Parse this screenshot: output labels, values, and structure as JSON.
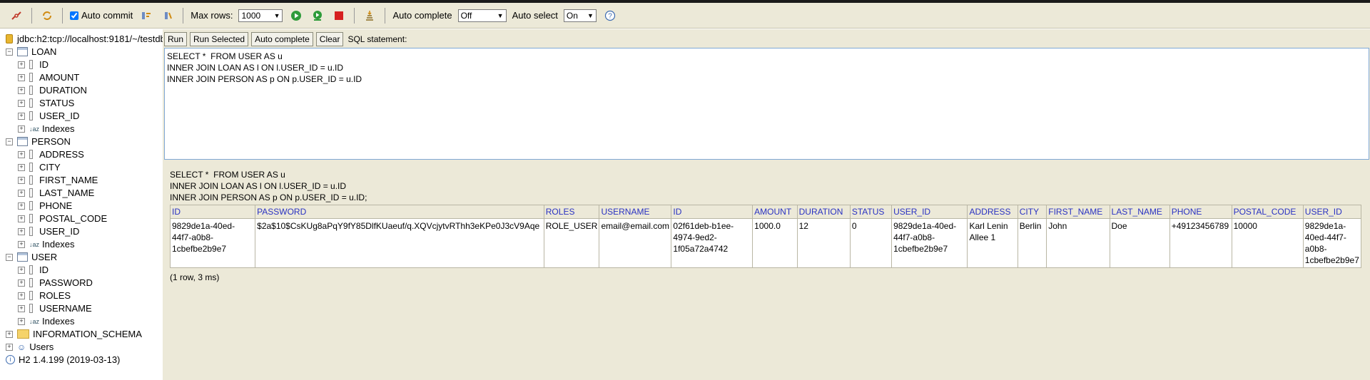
{
  "toolbar": {
    "auto_commit_label": "Auto commit",
    "max_rows_label": "Max rows:",
    "max_rows_value": "1000",
    "auto_complete_label": "Auto complete",
    "auto_complete_value": "Off",
    "auto_select_label": "Auto select",
    "auto_select_value": "On"
  },
  "tree": {
    "connection": "jdbc:h2:tcp://localhost:9181/~/testdb",
    "tables": [
      {
        "name": "LOAN",
        "columns": [
          "ID",
          "AMOUNT",
          "DURATION",
          "STATUS",
          "USER_ID"
        ],
        "indexes": "Indexes"
      },
      {
        "name": "PERSON",
        "columns": [
          "ADDRESS",
          "CITY",
          "FIRST_NAME",
          "LAST_NAME",
          "PHONE",
          "POSTAL_CODE",
          "USER_ID"
        ],
        "indexes": "Indexes"
      },
      {
        "name": "USER",
        "columns": [
          "ID",
          "PASSWORD",
          "ROLES",
          "USERNAME"
        ],
        "indexes": "Indexes"
      }
    ],
    "information_schema": "INFORMATION_SCHEMA",
    "users": "Users",
    "version": "H2 1.4.199 (2019-03-13)"
  },
  "editor": {
    "run": "Run",
    "run_selected": "Run Selected",
    "auto_complete": "Auto complete",
    "clear": "Clear",
    "sql_label": "SQL statement:",
    "sql": "SELECT *  FROM USER AS u\nINNER JOIN LOAN AS l ON l.USER_ID = u.ID\nINNER JOIN PERSON AS p ON p.USER_ID = u.ID"
  },
  "results": {
    "query": "SELECT *  FROM USER AS u\nINNER JOIN LOAN AS l ON l.USER_ID = u.ID\nINNER JOIN PERSON AS p ON p.USER_ID = u.ID;",
    "columns": [
      "ID",
      "PASSWORD",
      "ROLES",
      "USERNAME",
      "ID",
      "AMOUNT",
      "DURATION",
      "STATUS",
      "USER_ID",
      "ADDRESS",
      "CITY",
      "FIRST_NAME",
      "LAST_NAME",
      "PHONE",
      "POSTAL_CODE",
      "USER_ID"
    ],
    "rows": [
      [
        "9829de1a-40ed-44f7-a0b8-1cbefbe2b9e7",
        "$2a$10$CsKUg8aPqY9fY85DlfKUaeuf/q.XQVcjytvRThh3eKPe0J3cV9Aqe",
        "ROLE_USER",
        "email@email.com",
        "02f61deb-b1ee-4974-9ed2-1f05a72a4742",
        "1000.0",
        "12",
        "0",
        "9829de1a-40ed-44f7-a0b8-1cbefbe2b9e7",
        "Karl Lenin Allee 1",
        "Berlin",
        "John",
        "Doe",
        "+49123456789",
        "10000",
        "9829de1a-40ed-44f7-a0b8-1cbefbe2b9e7"
      ]
    ],
    "status": "(1 row, 3 ms)"
  }
}
